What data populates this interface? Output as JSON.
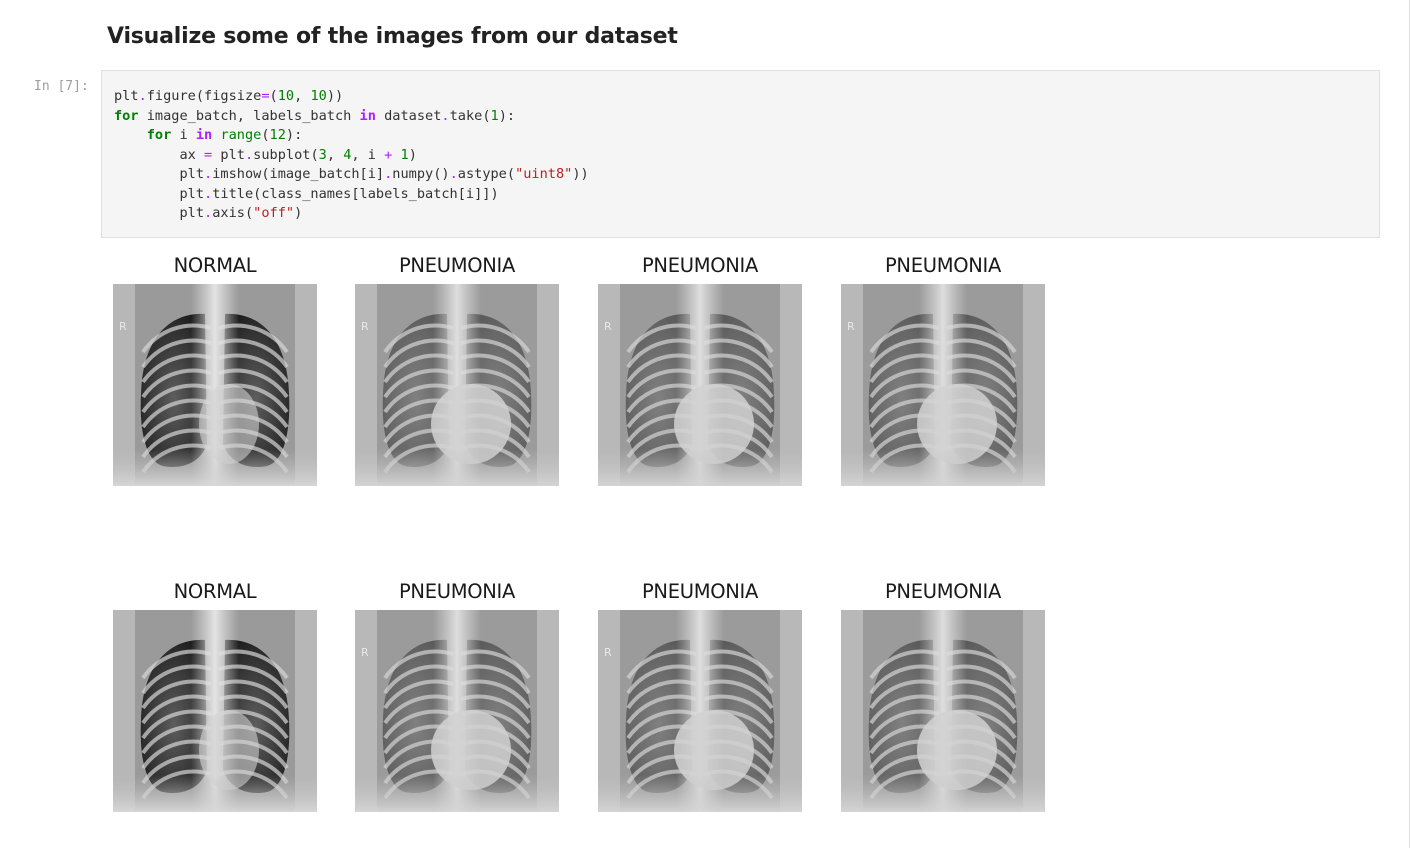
{
  "notebook": {
    "heading": "Visualize some of the images from our dataset",
    "cell_prompt": "In [7]:",
    "code_lines": [
      [
        {
          "t": "plt",
          "c": ""
        },
        {
          "t": ".",
          "c": "op"
        },
        {
          "t": "figure(figsize",
          "c": ""
        },
        {
          "t": "=",
          "c": "op"
        },
        {
          "t": "(",
          "c": ""
        },
        {
          "t": "10",
          "c": "mi"
        },
        {
          "t": ", ",
          "c": ""
        },
        {
          "t": "10",
          "c": "mi"
        },
        {
          "t": "))",
          "c": ""
        }
      ],
      [
        {
          "t": "for",
          "c": "k"
        },
        {
          "t": " image_batch, labels_batch ",
          "c": ""
        },
        {
          "t": "in",
          "c": "ow"
        },
        {
          "t": " dataset",
          "c": ""
        },
        {
          "t": ".",
          "c": "op"
        },
        {
          "t": "take(",
          "c": ""
        },
        {
          "t": "1",
          "c": "mi"
        },
        {
          "t": "):",
          "c": ""
        }
      ],
      [
        {
          "t": "    ",
          "c": ""
        },
        {
          "t": "for",
          "c": "k"
        },
        {
          "t": " i ",
          "c": ""
        },
        {
          "t": "in",
          "c": "ow"
        },
        {
          "t": " ",
          "c": ""
        },
        {
          "t": "range",
          "c": "nb"
        },
        {
          "t": "(",
          "c": ""
        },
        {
          "t": "12",
          "c": "mi"
        },
        {
          "t": "):",
          "c": ""
        }
      ],
      [
        {
          "t": "        ax ",
          "c": ""
        },
        {
          "t": "=",
          "c": "op"
        },
        {
          "t": " plt",
          "c": ""
        },
        {
          "t": ".",
          "c": "op"
        },
        {
          "t": "subplot(",
          "c": ""
        },
        {
          "t": "3",
          "c": "mi"
        },
        {
          "t": ", ",
          "c": ""
        },
        {
          "t": "4",
          "c": "mi"
        },
        {
          "t": ", i ",
          "c": ""
        },
        {
          "t": "+",
          "c": "op"
        },
        {
          "t": " ",
          "c": ""
        },
        {
          "t": "1",
          "c": "mi"
        },
        {
          "t": ")",
          "c": ""
        }
      ],
      [
        {
          "t": "        plt",
          "c": ""
        },
        {
          "t": ".",
          "c": "op"
        },
        {
          "t": "imshow(image_batch[i]",
          "c": ""
        },
        {
          "t": ".",
          "c": "op"
        },
        {
          "t": "numpy()",
          "c": ""
        },
        {
          "t": ".",
          "c": "op"
        },
        {
          "t": "astype(",
          "c": ""
        },
        {
          "t": "\"uint8\"",
          "c": "s"
        },
        {
          "t": "))",
          "c": ""
        }
      ],
      [
        {
          "t": "        plt",
          "c": ""
        },
        {
          "t": ".",
          "c": "op"
        },
        {
          "t": "title(class_names[labels_batch[i]])",
          "c": ""
        }
      ],
      [
        {
          "t": "        plt",
          "c": ""
        },
        {
          "t": ".",
          "c": "op"
        },
        {
          "t": "axis(",
          "c": ""
        },
        {
          "t": "\"off\"",
          "c": "s"
        },
        {
          "t": ")",
          "c": ""
        }
      ]
    ]
  },
  "figure": {
    "panels": [
      {
        "title": "NORMAL",
        "marker": "R"
      },
      {
        "title": "PNEUMONIA",
        "marker": "R"
      },
      {
        "title": "PNEUMONIA",
        "marker": "R"
      },
      {
        "title": "PNEUMONIA",
        "marker": "R"
      },
      {
        "title": "NORMAL",
        "marker": ""
      },
      {
        "title": "PNEUMONIA",
        "marker": "R"
      },
      {
        "title": "PNEUMONIA",
        "marker": "R"
      },
      {
        "title": "PNEUMONIA",
        "marker": ""
      }
    ]
  }
}
